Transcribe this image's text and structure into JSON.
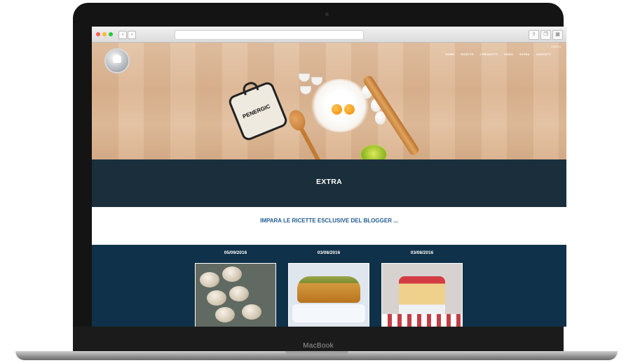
{
  "device": {
    "brand_label": "MacBook"
  },
  "browser": {
    "back_icon": "chevron-left-icon",
    "forward_icon": "chevron-right-icon"
  },
  "site": {
    "menu": [
      "HOME",
      "RICETTE",
      "I PRODOTTI",
      "VIDEO",
      "EXTRA",
      "CONTATTI"
    ],
    "search_label": "CERCA",
    "potholder_text": "PENERGIC"
  },
  "sections": {
    "extra_title": "EXTRA",
    "subtitle": "IMPARA LE RICETTE ESCLUSIVE DEL BLOGGER ..."
  },
  "posts": [
    {
      "date": "05/09/2016"
    },
    {
      "date": "03/08/2016"
    },
    {
      "date": "03/08/2016"
    }
  ],
  "colors": {
    "dark_band": "#1a2e3b",
    "navy": "#0f3149",
    "link_blue": "#1f5b90"
  }
}
